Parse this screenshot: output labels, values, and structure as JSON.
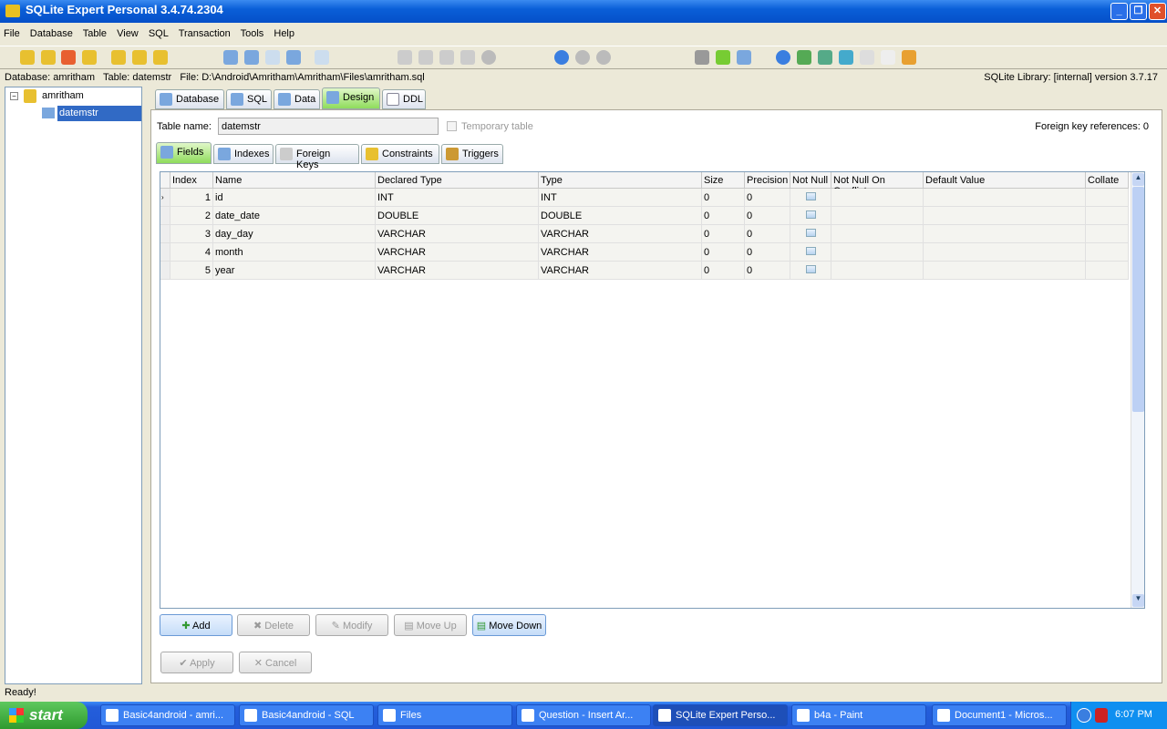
{
  "window": {
    "title": "SQLite Expert Personal 3.4.74.2304"
  },
  "menu": [
    "File",
    "Database",
    "Table",
    "View",
    "SQL",
    "Transaction",
    "Tools",
    "Help"
  ],
  "infobar": {
    "left": "Database: amritham   Table: datemstr   File: D:\\Android\\Amritham\\Amritham\\Files\\amritham.sql",
    "right": "SQLite Library: [internal] version 3.7.17"
  },
  "tree": {
    "database": "amritham",
    "table": "datemstr"
  },
  "tabs": [
    "Database",
    "SQL",
    "Data",
    "Design",
    "DDL"
  ],
  "design": {
    "table_name_label": "Table name:",
    "table_name": "datemstr",
    "temporary_label": "Temporary table",
    "fk_refs": "Foreign key references: 0"
  },
  "subtabs": [
    "Fields",
    "Indexes",
    "Foreign Keys",
    "Constraints",
    "Triggers"
  ],
  "grid": {
    "columns": [
      "Index",
      "Name",
      "Declared Type",
      "Type",
      "Size",
      "Precision",
      "Not Null",
      "Not Null On Conflict",
      "Default Value",
      "Collate"
    ],
    "rows": [
      {
        "index": "1",
        "name": "id",
        "declared": "INT",
        "type": "INT",
        "size": "0",
        "precision": "0"
      },
      {
        "index": "2",
        "name": "date_date",
        "declared": "DOUBLE",
        "type": "DOUBLE",
        "size": "0",
        "precision": "0"
      },
      {
        "index": "3",
        "name": "day_day",
        "declared": "VARCHAR",
        "type": "VARCHAR",
        "size": "0",
        "precision": "0"
      },
      {
        "index": "4",
        "name": "month",
        "declared": "VARCHAR",
        "type": "VARCHAR",
        "size": "0",
        "precision": "0"
      },
      {
        "index": "5",
        "name": "year",
        "declared": "VARCHAR",
        "type": "VARCHAR",
        "size": "0",
        "precision": "0"
      }
    ]
  },
  "buttons": {
    "add": "Add",
    "delete": "Delete",
    "modify": "Modify",
    "move_up": "Move Up",
    "move_down": "Move Down",
    "apply": "Apply",
    "cancel": "Cancel"
  },
  "status": "Ready!",
  "taskbar": {
    "start": "start",
    "items": [
      "Basic4android - amri...",
      "Basic4android - SQL",
      "Files",
      "Question - Insert Ar...",
      "SQLite Expert Perso...",
      "b4a - Paint",
      "Document1 - Micros..."
    ],
    "clock": "6:07 PM"
  }
}
